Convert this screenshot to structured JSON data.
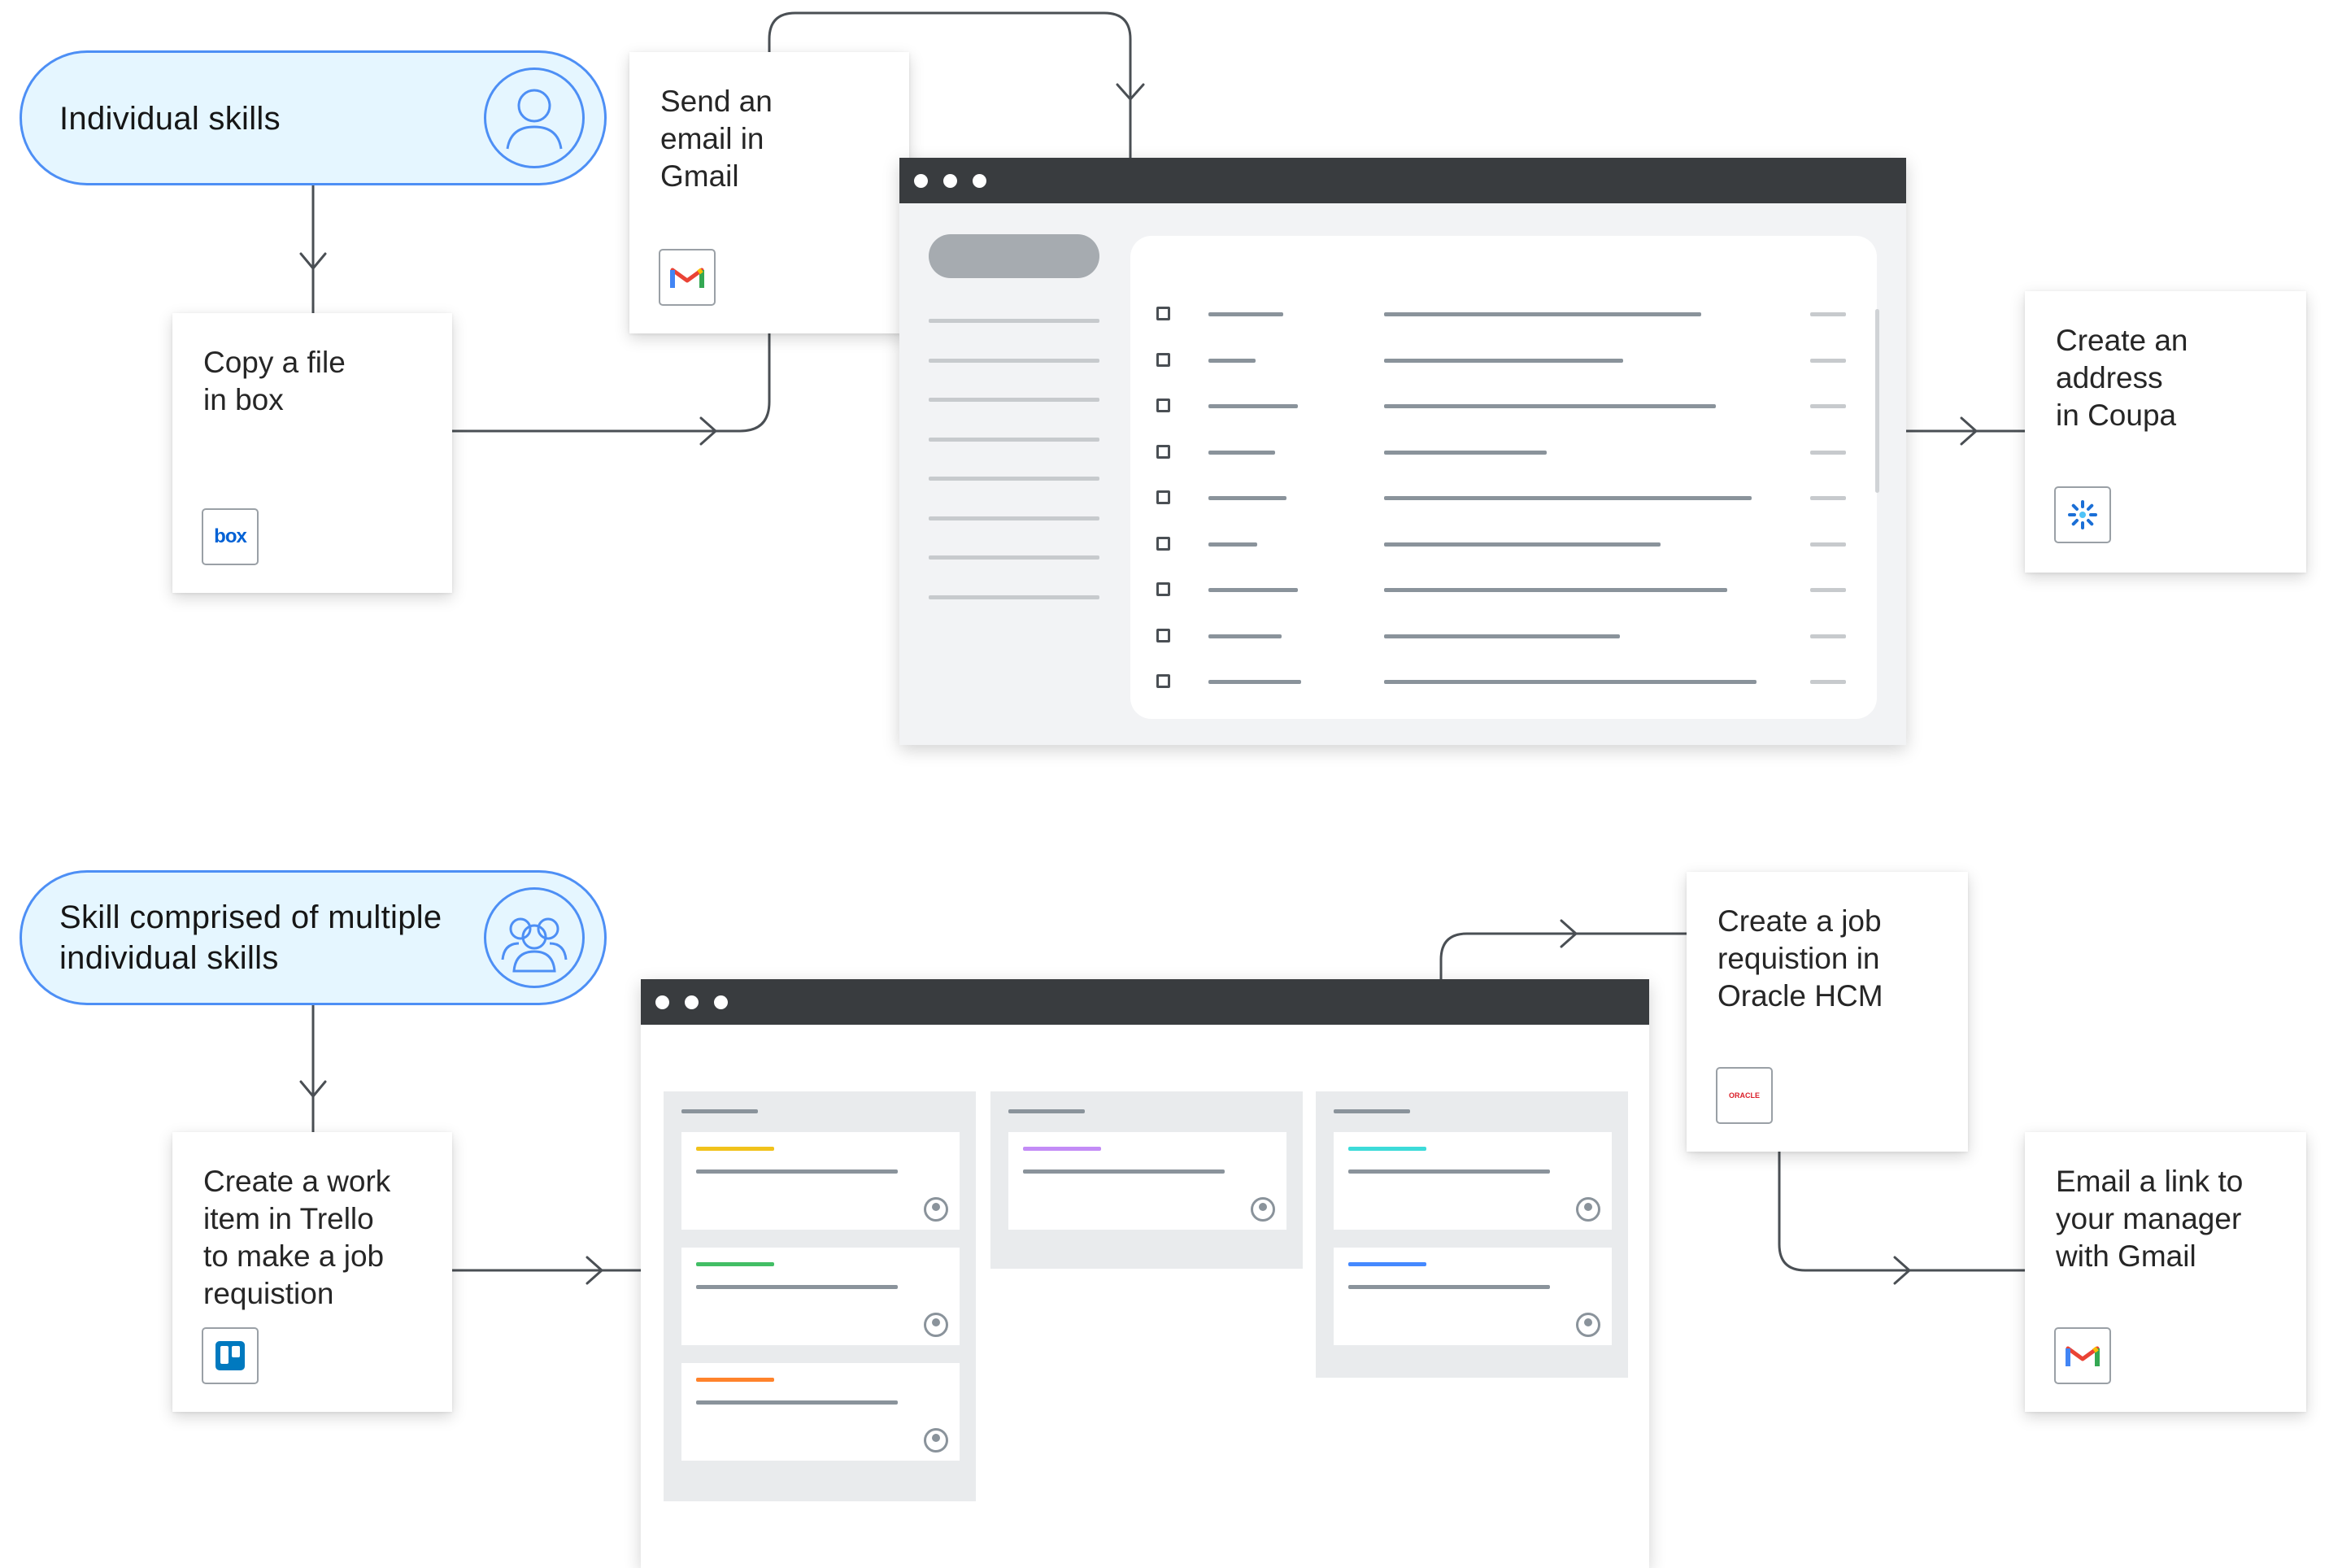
{
  "section_individual": {
    "label": "Individual skills",
    "icon": "user-icon"
  },
  "section_composite": {
    "label": "Skill comprised of multiple\nindividual skills",
    "icon": "group-icon"
  },
  "cards": {
    "box": {
      "title": "Copy a file\nin box",
      "logo": "box-logo",
      "logo_text": "box"
    },
    "gmail_send": {
      "title": "Send an\nemail in\nGmail",
      "logo": "gmail-icon"
    },
    "coupa": {
      "title": "Create an\naddress\nin Coupa",
      "logo": "coupa-icon"
    },
    "trello": {
      "title": "Create a work\nitem in Trello\nto make a job\nrequistion",
      "logo": "trello-icon"
    },
    "oracle": {
      "title": "Create a job\nrequistion in\nOracle HCM",
      "logo": "oracle-logo",
      "logo_text": "ORACLE"
    },
    "gmail_email": {
      "title": "Email a link to\nyour manager\nwith Gmail",
      "logo": "gmail-icon"
    }
  },
  "colors": {
    "pill_fill": "#e5f6ff",
    "pill_border": "#4d8ff5",
    "titlebar": "#393c3f",
    "connector": "#4a4f54",
    "trello_accents": [
      "#f1c21b",
      "#c38cf6",
      "#3ddbd9",
      "#42be65",
      "#4589ff",
      "#ff832b"
    ],
    "box_blue": "#0061d5",
    "oracle_red": "#da1e28"
  }
}
